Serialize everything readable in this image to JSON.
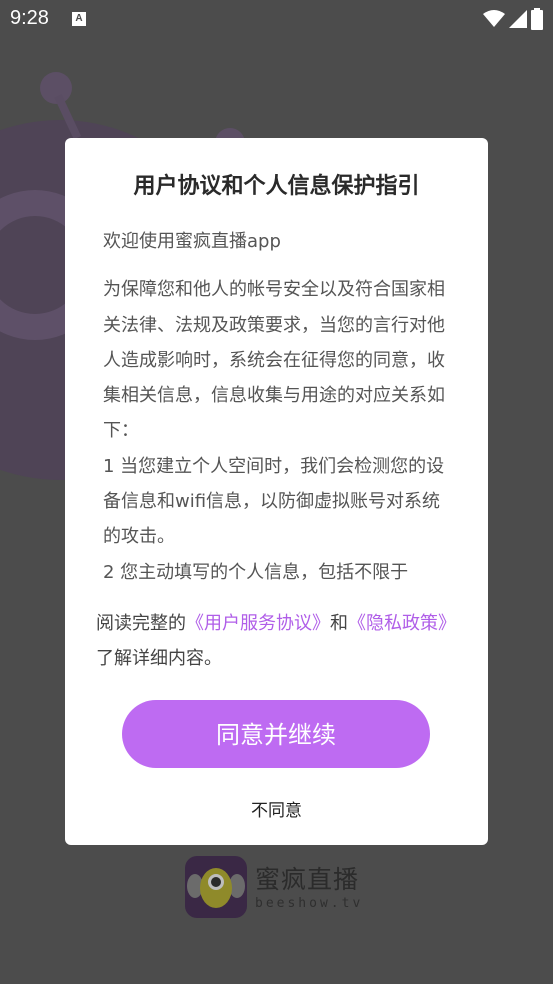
{
  "status_bar": {
    "time": "9:28",
    "a_icon": "A"
  },
  "dialog": {
    "title": "用户协议和个人信息保护指引",
    "welcome": "欢迎使用蜜疯直播app",
    "body_paragraphs": [
      "为保障您和他人的帐号安全以及符合国家相关法律、法规及政策要求，当您的言行对他人造成影响时，系统会在征得您的同意，收集相关信息，信息收集与用途的对应关系如下：",
      "1 当您建立个人空间时，我们会检测您的设备信息和wifi信息，以防御虚拟账号对系统的攻击。",
      "2 您主动填写的个人信息，包括不限于"
    ],
    "footer": {
      "prefix": "阅读完整的",
      "user_agreement_link": "《用户服务协议》",
      "and": "和",
      "privacy_link": "《隐私政策》",
      "suffix": "了解详细内容。"
    },
    "agree_label": "同意并继续",
    "disagree_label": "不同意"
  },
  "brand": {
    "name": "蜜疯直播",
    "domain": "beeshow.tv"
  },
  "colors": {
    "accent": "#be6bf2",
    "link": "#b05ee8",
    "overlay": "#4a4a4a"
  }
}
